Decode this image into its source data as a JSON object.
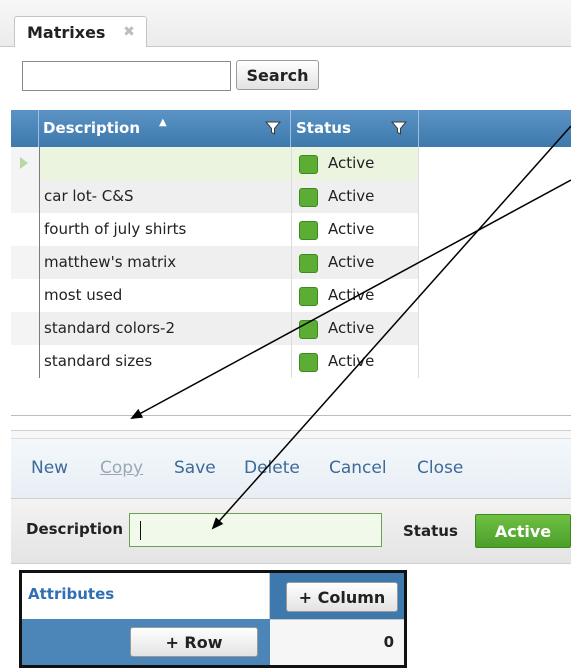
{
  "tab": {
    "title": "Matrixes",
    "close_icon": "close-icon"
  },
  "search": {
    "value": "",
    "placeholder": "",
    "button_label": "Search"
  },
  "grid": {
    "columns": [
      {
        "label": "Description",
        "sorted": "ascending",
        "filter_icon": "filter-icon"
      },
      {
        "label": "Status",
        "filter_icon": "filter-icon"
      }
    ],
    "rows": [
      {
        "description": "",
        "status": "Active",
        "selected": true
      },
      {
        "description": "car lot- C&S",
        "status": "Active"
      },
      {
        "description": "fourth of july shirts",
        "status": "Active"
      },
      {
        "description": "matthew's matrix",
        "status": "Active"
      },
      {
        "description": "most used",
        "status": "Active"
      },
      {
        "description": "standard colors-2",
        "status": "Active"
      },
      {
        "description": "standard sizes",
        "status": "Active"
      }
    ],
    "status_color": "#5cad33"
  },
  "toolbar": {
    "new": "New",
    "copy": "Copy",
    "save": "Save",
    "delete": "Delete",
    "cancel": "Cancel",
    "close": "Close"
  },
  "detail": {
    "description_label": "Description",
    "description_value": "",
    "status_label": "Status",
    "status_value": "Active"
  },
  "matrix": {
    "attributes_label": "Attributes",
    "add_column_label": "+ Column",
    "add_row_label": "+ Row",
    "cell_value": "0"
  },
  "colors": {
    "accent": "#3e79ad",
    "active_green": "#5cad33",
    "link": "#3d6a99"
  }
}
